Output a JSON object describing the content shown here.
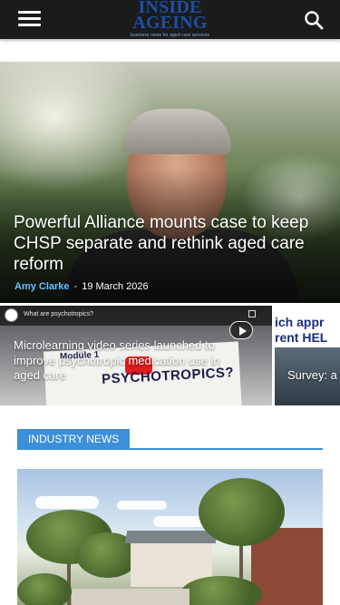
{
  "header": {
    "logo_main": "INSIDE AGEING",
    "logo_tagline": "business news for aged care services",
    "menu_icon": "hamburger-menu-icon",
    "search_icon": "search-icon",
    "background_color": "#1b1b1b"
  },
  "hero": {
    "title": "Powerful Alliance mounts case to keep CHSP separate and rethink aged care reform",
    "author": "Amy Clarke",
    "separator": "-",
    "date": "19 March 2026",
    "author_color": "#68c0ff"
  },
  "cards": [
    {
      "video_title": "What are psychotropics?",
      "video_module": "Module 1",
      "video_board_text": "PSYCHOTROPICS?",
      "title": "Microlearning video series launched to improve psychotropic medication use in aged care"
    },
    {
      "image_text_line1": "ich appr",
      "image_text_line2": "rent HEL",
      "title": "Survey: a yet to im"
    }
  ],
  "section": {
    "label": "INDUSTRY NEWS",
    "accent_color": "#3c8fd9"
  }
}
